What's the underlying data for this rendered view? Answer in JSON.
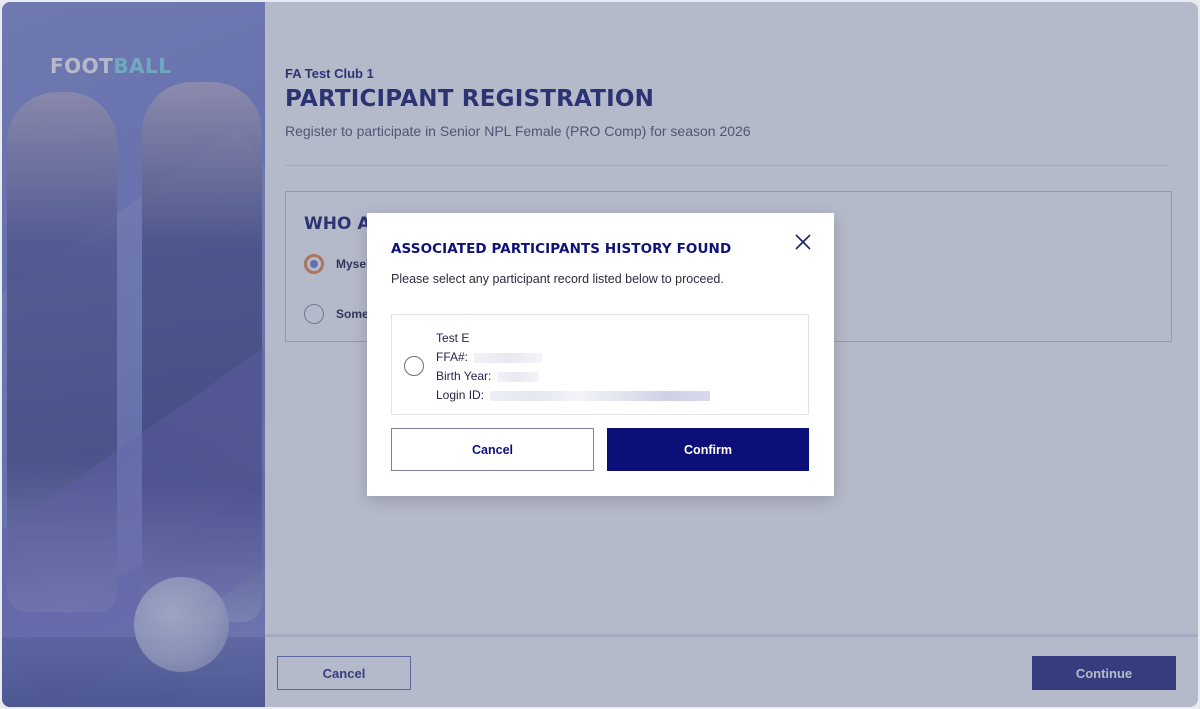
{
  "brand": {
    "logo_part1": "FOOT",
    "logo_part2": "BALL"
  },
  "page": {
    "club_name": "FA Test Club 1",
    "title": "PARTICIPANT REGISTRATION",
    "subtitle": "Register to participate in Senior NPL Female (PRO Comp) for season 2026"
  },
  "who_section": {
    "title": "WHO A",
    "options": [
      {
        "label": "Mysel",
        "selected": true
      },
      {
        "label": "Some",
        "selected": false
      }
    ]
  },
  "footer": {
    "cancel_label": "Cancel",
    "continue_label": "Continue"
  },
  "modal": {
    "title": "ASSOCIATED PARTICIPANTS HISTORY FOUND",
    "description": "Please select any participant record listed below to proceed.",
    "record": {
      "name": "Test E",
      "ffa_label": "FFA#:",
      "birth_year_label": "Birth Year:",
      "login_id_label": "Login ID:"
    },
    "cancel_label": "Cancel",
    "confirm_label": "Confirm",
    "close_icon": "close-icon"
  },
  "colors": {
    "brand_navy": "#0d0f78",
    "accent_cyan": "#8fe0ee",
    "selected_radio_ring": "#f08c4a"
  }
}
